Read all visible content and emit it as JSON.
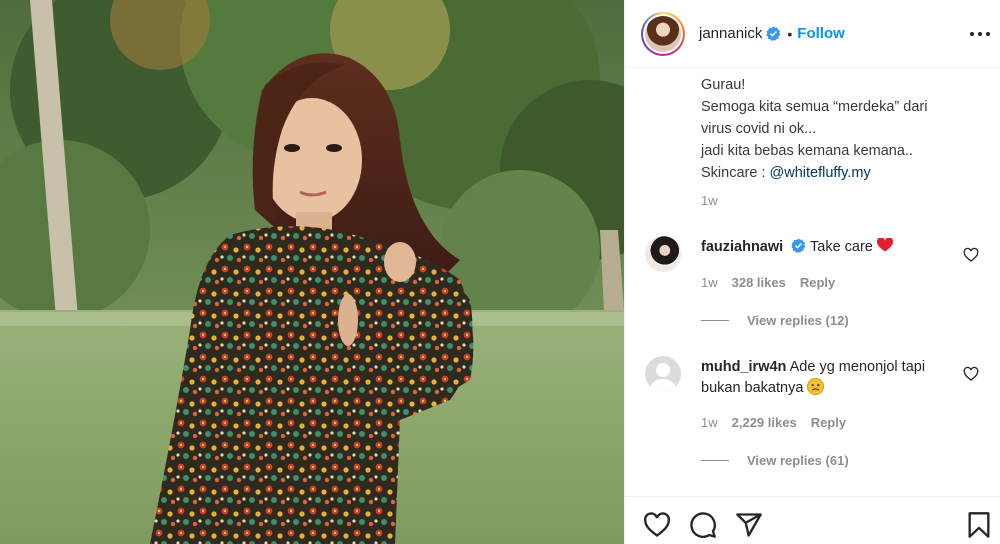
{
  "post": {
    "username": "jannanick",
    "separator": "•",
    "follow_label": "Follow",
    "accent_color": "#0095f6",
    "caption_lines": [
      "Gurau!",
      "Semoga kita semua “merdeka” dari",
      "virus covid ni ok...",
      "jadi kita bebas kemana kemana..",
      "Skincare : "
    ],
    "mention": "@whitefluffy.my",
    "time": "1w"
  },
  "comments": [
    {
      "username": "fauziahnawi",
      "verified": true,
      "text": "Take care",
      "emoji": "red-heart-emoji",
      "time": "1w",
      "likes": "328 likes",
      "reply_label": "Reply",
      "view_replies": "View replies (12)"
    },
    {
      "username": "muhd_irw4n",
      "verified": false,
      "text": "Ade yg menonjol tapi bukan bakatnya",
      "emoji": "worried-face-emoji",
      "time": "1w",
      "likes": "2,229 likes",
      "reply_label": "Reply",
      "view_replies": "View replies (61)"
    }
  ],
  "icons": {
    "header": [
      "verified-badge-icon",
      "more-options-icon"
    ],
    "actions": [
      "like-heart-icon",
      "comment-icon",
      "share-icon",
      "save-bookmark-icon"
    ]
  }
}
